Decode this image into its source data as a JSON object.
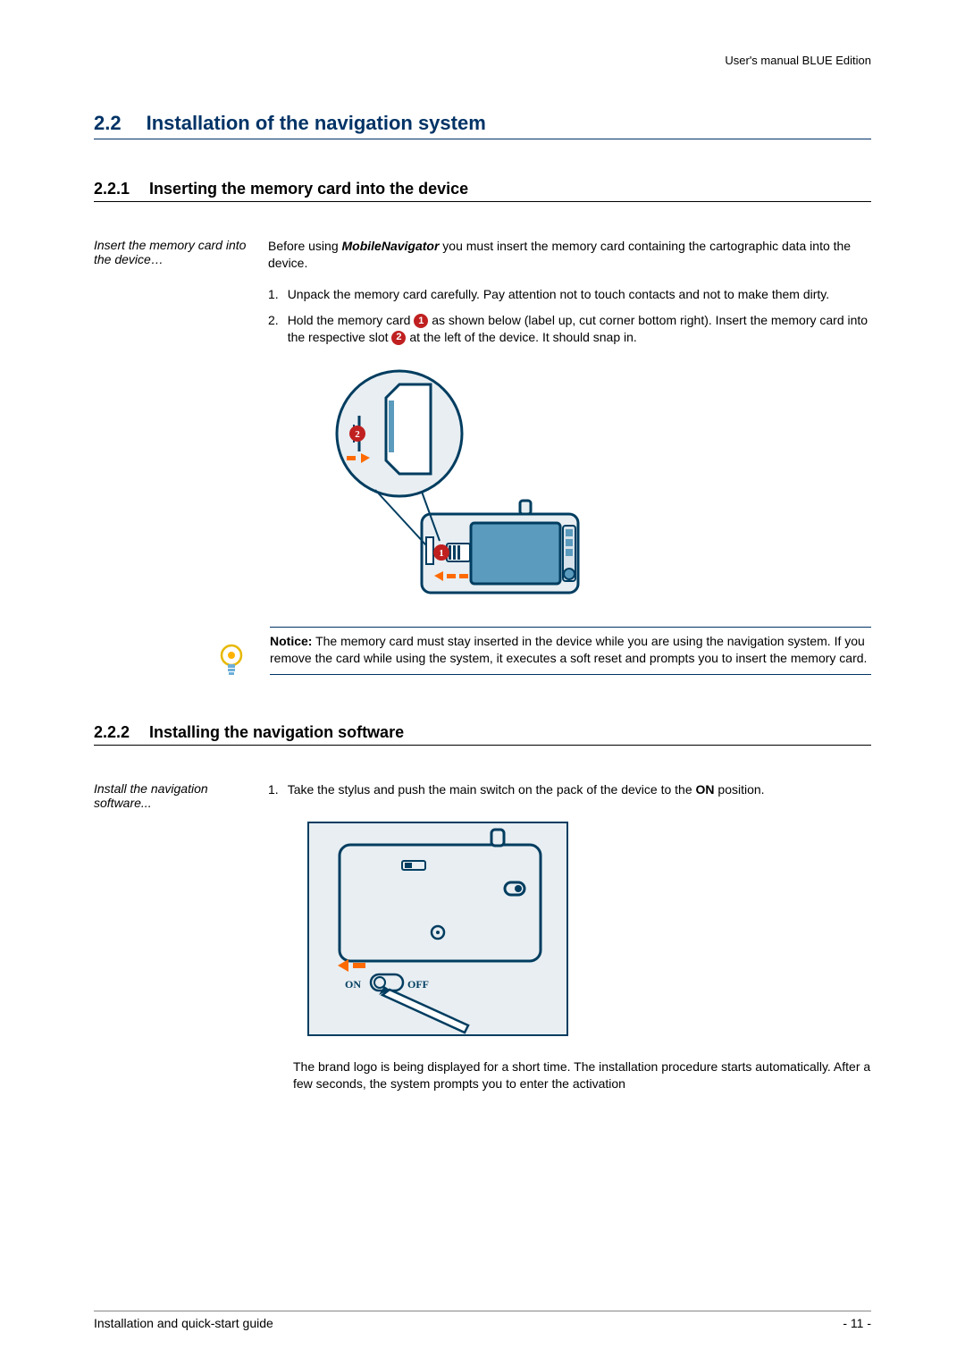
{
  "header": {
    "right": "User's manual BLUE Edition"
  },
  "section": {
    "num": "2.2",
    "title": "Installation of the navigation system"
  },
  "sub1": {
    "num": "2.2.1",
    "title": "Inserting the memory card into the device",
    "side": "Insert the memory card into the device…",
    "intro_pre": "Before using ",
    "intro_bold": "MobileNavigator",
    "intro_post": " you must insert the memory card containing the cartographic data into the device.",
    "step1_marker": "1.",
    "step1": "Unpack the memory card carefully. Pay attention not to touch contacts and not to make them dirty.",
    "step2_marker": "2.",
    "step2_a": "Hold the memory card ",
    "step2_b": " as shown below (label up, cut corner bottom right). Insert the memory card into the respective slot ",
    "step2_c": " at the left of the device. It should snap in.",
    "badge1": "1",
    "badge2": "2"
  },
  "notice": {
    "label": "Notice:",
    "text": " The memory card must stay inserted in the device while you are using the navigation system. If you remove the card while using the system, it executes a soft reset and prompts you to insert the memory card."
  },
  "sub2": {
    "num": "2.2.2",
    "title": "Installing the navigation software",
    "side": "Install the navigation software...",
    "step1_marker": "1.",
    "step1_a": "Take the stylus and push the main switch on the pack of the device to the ",
    "step1_bold": "ON",
    "step1_b": " position.",
    "caption": "The brand logo is being displayed for a short time. The installation procedure starts automatically. After a few seconds, the system prompts you to enter the activation"
  },
  "illus2": {
    "on": "ON",
    "off": "OFF"
  },
  "footer": {
    "left": "Installation and quick-start guide",
    "right": "- 11 -"
  }
}
